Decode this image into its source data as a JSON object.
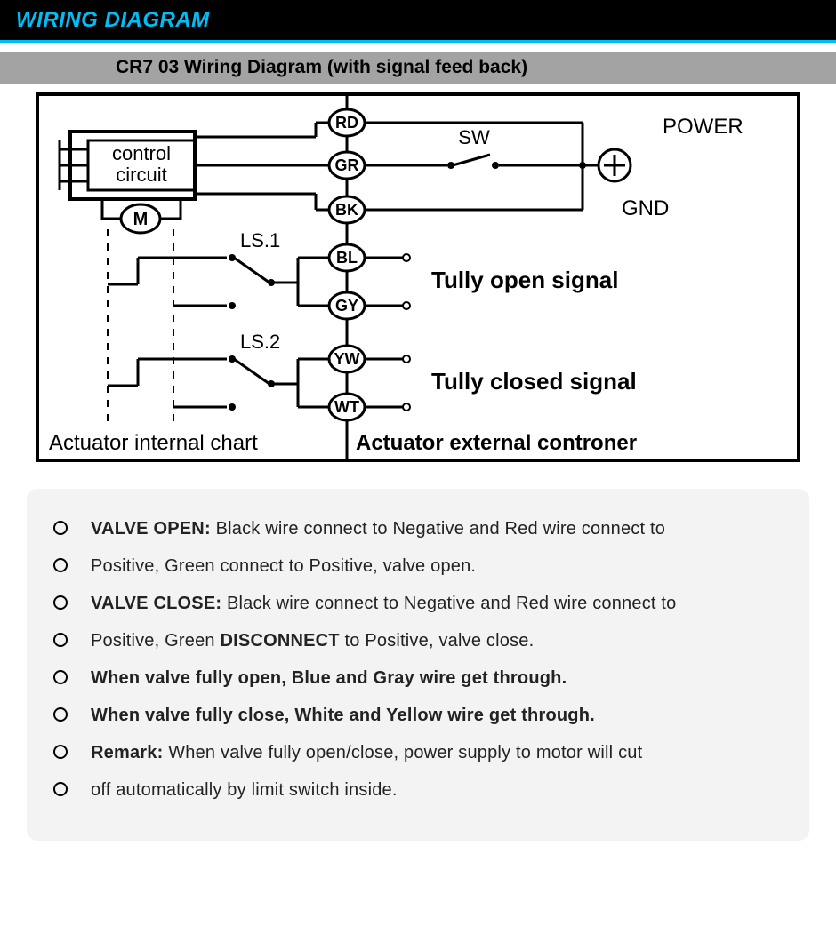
{
  "header": {
    "title": "WIRING DIAGRAM"
  },
  "subheader": {
    "title": "CR7 03 Wiring Diagram (with signal feed back)"
  },
  "diagram": {
    "control_box": "control\ncircuit",
    "motor": "M",
    "terminals": [
      "RD",
      "GR",
      "BK",
      "BL",
      "GY",
      "YW",
      "WT"
    ],
    "ls1": "LS.1",
    "ls2": "LS.2",
    "sw": "SW",
    "power": "POWER",
    "gnd": "GND",
    "open_signal": "Tully open signal",
    "close_signal": "Tully closed signal",
    "left_caption": "Actuator internal chart",
    "right_caption": "Actuator external controner"
  },
  "desc": [
    {
      "b1": "VALVE OPEN:",
      "t1": " Black wire connect to Negative and Red wire connect to"
    },
    {
      "t1": "Positive, Green connect to Positive, valve open."
    },
    {
      "b1": "VALVE CLOSE:",
      "t1": " Black wire connect to Negative and Red wire connect to"
    },
    {
      "t1": "Positive, Green ",
      "b2": "DISCONNECT",
      "t2": " to Positive, valve close."
    },
    {
      "b1": "When valve fully open, Blue and Gray wire get through."
    },
    {
      "b1": "When valve fully close, White and Yellow wire get through."
    },
    {
      "b1": "Remark:",
      "t1": " When valve fully open/close, power supply to motor will cut"
    },
    {
      "t1": "off automatically by limit switch inside."
    }
  ]
}
